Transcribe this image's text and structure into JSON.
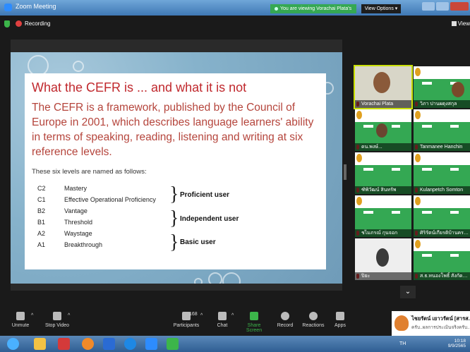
{
  "window": {
    "title": "Zoom Meeting",
    "viewing_banner": "You are viewing Vorachai Plata's screen",
    "view_options": "View Options"
  },
  "topbar": {
    "recording": "Recording",
    "view": "View"
  },
  "slide": {
    "title": "What the CEFR is ... and what it is not",
    "paragraph": "The CEFR is a framework, published by the Council of Europe in 2001, which describes language learners' ability in terms of speaking, reading, listening and writing at six reference levels.",
    "intro": "These six levels are named as follows:",
    "levels": [
      {
        "code": "C2",
        "name": "Mastery"
      },
      {
        "code": "C1",
        "name": "Effective Operational Proficiency"
      },
      {
        "code": "B2",
        "name": "Vantage"
      },
      {
        "code": "B1",
        "name": "Threshold"
      },
      {
        "code": "A2",
        "name": "Waystage"
      },
      {
        "code": "A1",
        "name": "Breakthrough"
      }
    ],
    "groups": [
      "Proficient user",
      "Independent user",
      "Basic user"
    ]
  },
  "participants_panel": {
    "tiles": [
      {
        "name": "Vorachai Plata"
      },
      {
        "name": "วิภา ปานผดุงสกุล"
      },
      {
        "name": "ดน.พงษ์..."
      },
      {
        "name": "Tanmanee Hanchin"
      },
      {
        "name": "ฑิพิวัฒน์ สินทรัพ"
      },
      {
        "name": "Kulanpetch Somton"
      },
      {
        "name": "ชไมภรณ์ กุนจอก"
      },
      {
        "name": "ศิริรัตน์เกียรติบ้านครอ..."
      },
      {
        "name": "ปิยะ"
      },
      {
        "name": "ส.ธ.หนองโพธิ์ สังกัดกัน..."
      }
    ]
  },
  "toolbar": {
    "unmute": "Unmute",
    "stop_video": "Stop Video",
    "participants": "Participants",
    "participants_count": "168",
    "chat": "Chat",
    "share_screen": "Share Screen",
    "record": "Record",
    "reactions": "Reactions",
    "apps": "Apps"
  },
  "notification": {
    "sender": "ไชยรัตน์ เยาวรัตน์ [สารส...",
    "message": "ครับ..ผลการประเมินจริงครับ..."
  },
  "taskbar": {
    "lang": "TH",
    "time": "10:18",
    "date": "9/9/2565"
  },
  "colors": {
    "accent_green": "#35a853",
    "slide_title_red": "#c0282d",
    "recording_red": "#e04040"
  }
}
